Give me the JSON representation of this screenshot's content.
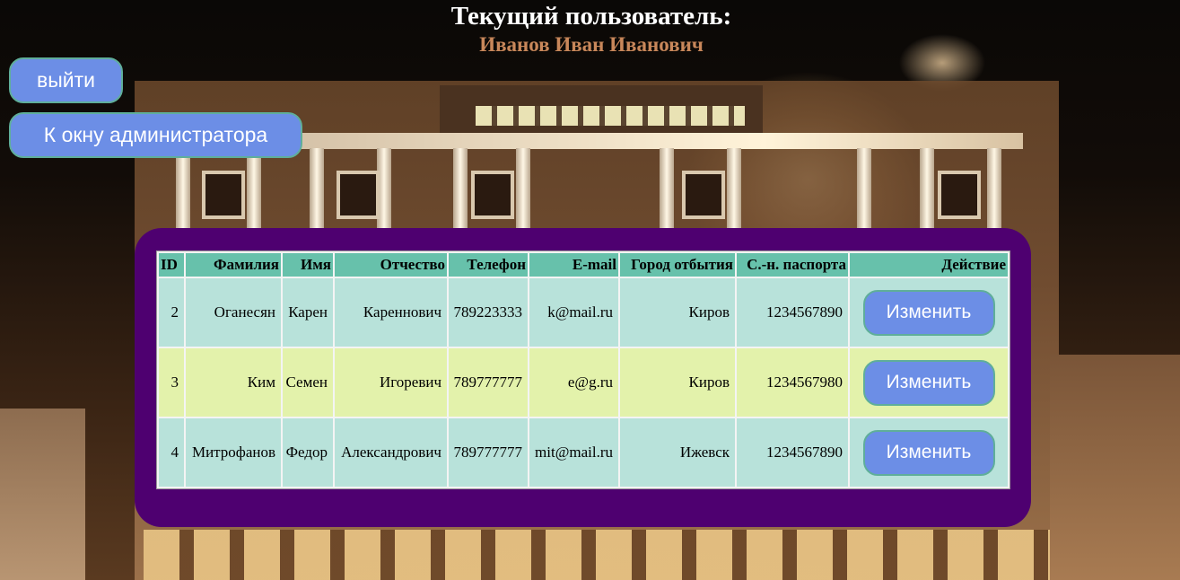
{
  "header": {
    "title": "Текущий пользователь:",
    "user_name": "Иванов Иван Иванович"
  },
  "buttons": {
    "logout": "выйти",
    "admin": "К окну администратора"
  },
  "table": {
    "columns": [
      "ID",
      "Фамилия",
      "Имя",
      "Отчество",
      "Телефон",
      "E-mail",
      "Город отбытия",
      "С.-н. паспорта",
      "Действие"
    ],
    "rows": [
      {
        "id": "2",
        "last": "Оганесян",
        "first": "Карен",
        "middle": "Кареннович",
        "phone": "789223333",
        "email": "k@mail.ru",
        "city": "Киров",
        "passport": "1234567890",
        "action": "Изменить"
      },
      {
        "id": "3",
        "last": "Ким",
        "first": "Семен",
        "middle": "Игоревич",
        "phone": "789777777",
        "email": "e@g.ru",
        "city": "Киров",
        "passport": "1234567980",
        "action": "Изменить"
      },
      {
        "id": "4",
        "last": "Митрофанов",
        "first": "Федор",
        "middle": "Александрович",
        "phone": "789777777",
        "email": "mit@mail.ru",
        "city": "Ижевск",
        "passport": "1234567890",
        "action": "Изменить"
      }
    ]
  },
  "colors": {
    "panel": "#4e0070",
    "header_cell": "#67c1ab",
    "row_teal": "#b8e2da",
    "row_yellow": "#e3f2ab",
    "button": "#6c8ee6",
    "user_name": "#c8875a"
  }
}
